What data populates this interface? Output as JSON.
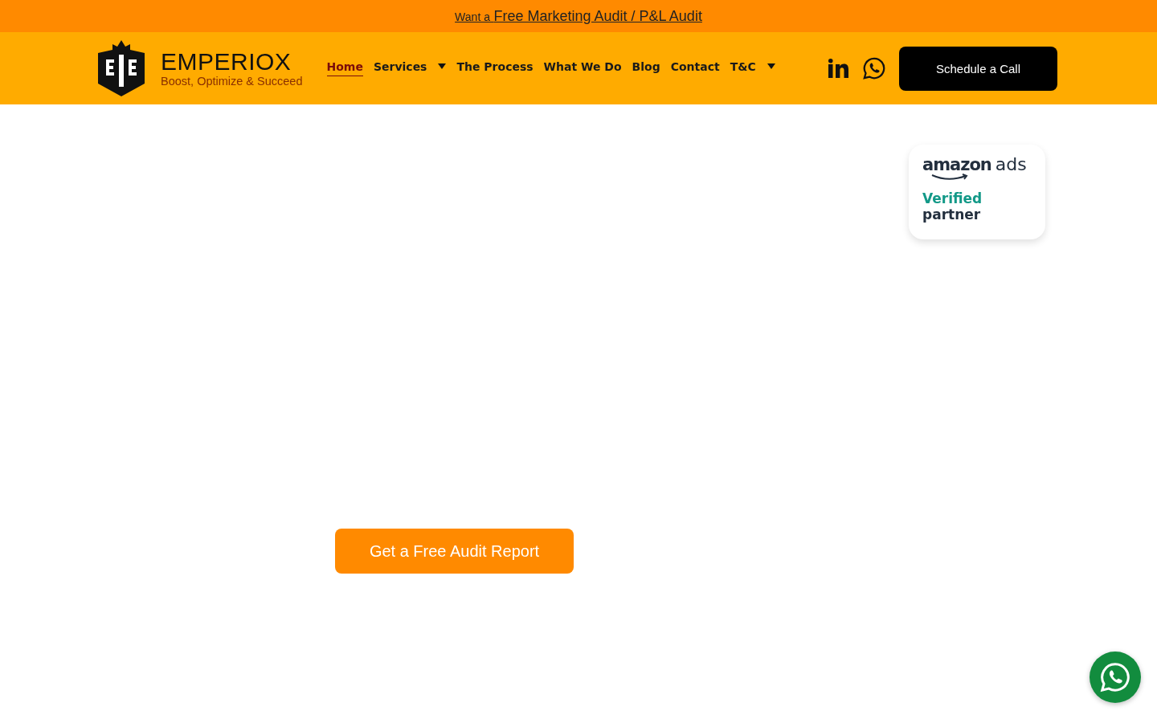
{
  "announcement": {
    "prefix": "Want a",
    "link": "Free Marketing Audit / P&L Audit"
  },
  "brand": {
    "name": "EMPERIOX",
    "tagline": "Boost, Optimize & Succeed"
  },
  "nav": [
    {
      "label": "Home",
      "selected": true,
      "kind": "link"
    },
    {
      "label": "Services",
      "selected": false,
      "kind": "dropdown"
    },
    {
      "label": "The Process",
      "selected": false,
      "kind": "link"
    },
    {
      "label": "What We Do",
      "selected": false,
      "kind": "link"
    },
    {
      "label": "Blog",
      "selected": false,
      "kind": "link"
    },
    {
      "label": "Contact",
      "selected": false,
      "kind": "link"
    },
    {
      "label": "T&C",
      "selected": false,
      "kind": "dropdown"
    }
  ],
  "cta": "Schedule a Call",
  "badge": {
    "word_1": "amazon",
    "word_2": "ads",
    "line_1": "Verified",
    "line_2": "partner"
  },
  "hero_button": "Get a Free Audit Report"
}
